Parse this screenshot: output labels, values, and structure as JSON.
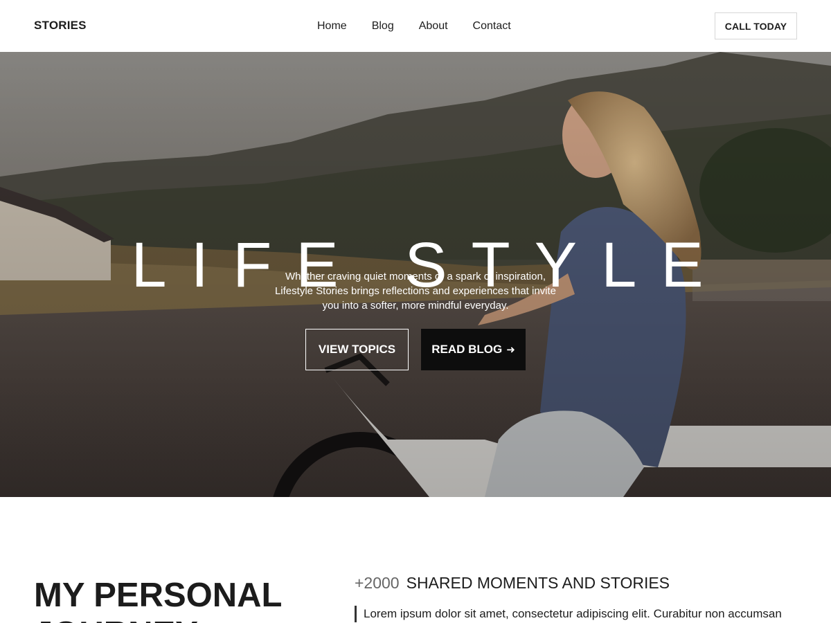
{
  "header": {
    "logo": "STORIES",
    "nav": [
      "Home",
      "Blog",
      "About",
      "Contact"
    ],
    "cta_label": "CALL TODAY"
  },
  "hero": {
    "title": "LIFE STYLE",
    "subtitle": "Whether craving quiet moments or a spark of inspiration, Lifestyle Stories brings reflections and experiences that invite you into a softer, more mindful everyday.",
    "button_topics": "VIEW TOPICS",
    "button_blog": "READ BLOG",
    "button_blog_icon": "arrow-right-icon"
  },
  "journey": {
    "title": "MY PERSONAL JOURNEY",
    "stat_number": "+2000",
    "stat_label": "SHARED MOMENTS AND STORIES",
    "quote": "Lorem ipsum dolor sit amet, consectetur adipiscing elit. Curabitur non accumsan"
  }
}
